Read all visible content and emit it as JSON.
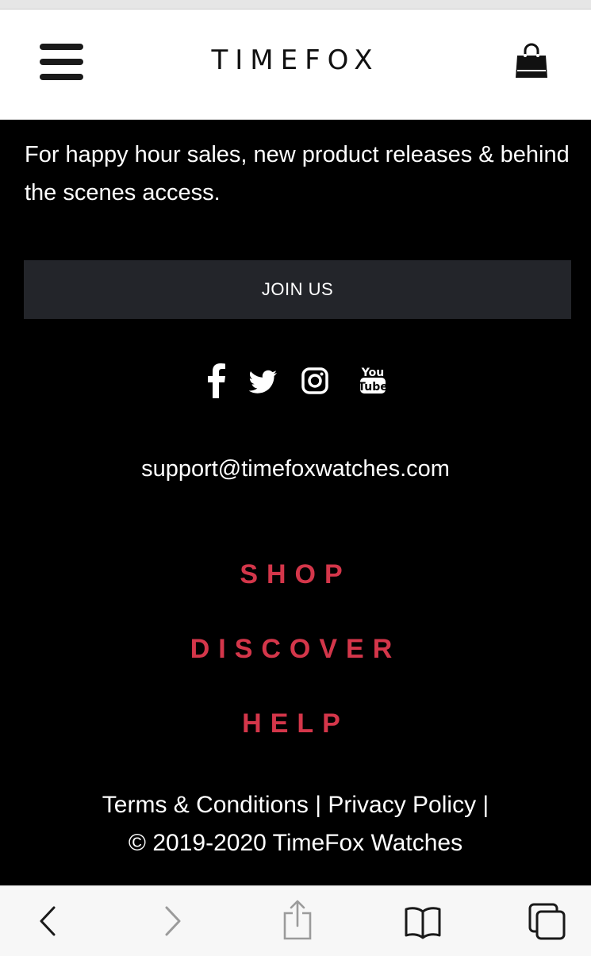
{
  "header": {
    "logo_text": "TIMEFOX"
  },
  "newsletter": {
    "tagline": "For happy hour sales, new product releases & behind the scenes access.",
    "join_label": "JOIN US"
  },
  "socials": {
    "icons": [
      "facebook-icon",
      "twitter-icon",
      "instagram-icon",
      "youtube-icon"
    ],
    "youtube_top": "You",
    "youtube_bottom": "Tube"
  },
  "contact": {
    "email": "support@timefoxwatches.com"
  },
  "footer_nav": {
    "shop": "SHOP",
    "discover": "DISCOVER",
    "help": "HELP"
  },
  "legal": {
    "terms": "Terms & Conditions",
    "sep1": " | ",
    "privacy": "Privacy Policy",
    "sep2": " |",
    "copyright": "© 2019-2020 TimeFox Watches"
  },
  "colors": {
    "accent_red": "#d4364a",
    "background": "#000000",
    "button_bg": "#23252a"
  },
  "browser_toolbar": {
    "icons": [
      "back-icon",
      "forward-icon",
      "share-icon",
      "bookmarks-icon",
      "tabs-icon"
    ]
  }
}
